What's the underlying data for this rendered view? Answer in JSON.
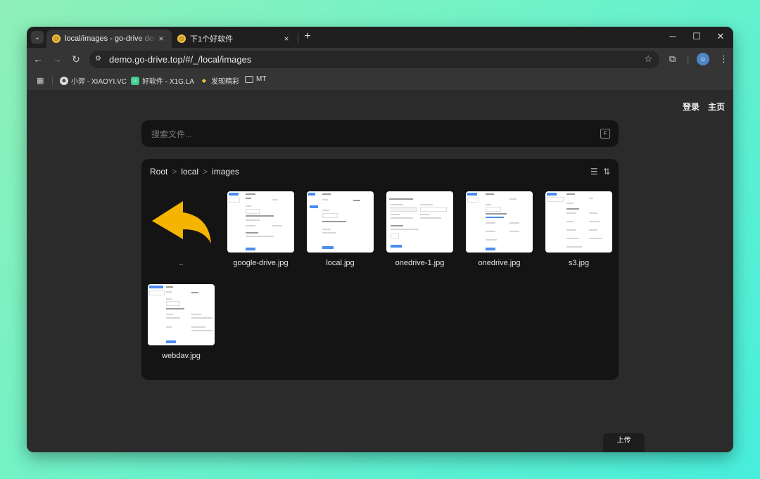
{
  "browser": {
    "tabs": [
      {
        "title": "local/images - go-drive demo",
        "close": "×",
        "favicon": "😉"
      },
      {
        "title": "下1个好软件",
        "close": "×",
        "favicon": "😉"
      }
    ],
    "new_tab": "+",
    "window_controls": {
      "minimize": "─",
      "maximize": "☐",
      "close": "✕"
    },
    "nav": {
      "back": "←",
      "forward": "→",
      "reload": "↻"
    },
    "url": "demo.go-drive.top/#/_/local/images",
    "bookmarks": [
      {
        "label": "小羿 - XIAOYI.VC"
      },
      {
        "label": "好软件 - X1G.LA"
      },
      {
        "label": "发现精彩"
      },
      {
        "label": "MT"
      }
    ]
  },
  "page": {
    "login": "登录",
    "home": "主页",
    "search_placeholder": "搜索文件...",
    "search_shortcut": "F",
    "breadcrumb": [
      "Root",
      "local",
      "images"
    ],
    "breadcrumb_separator": ">",
    "parent_label": "..",
    "files": [
      {
        "name": "google-drive.jpg"
      },
      {
        "name": "local.jpg"
      },
      {
        "name": "onedrive-1.jpg"
      },
      {
        "name": "onedrive.jpg"
      },
      {
        "name": "s3.jpg"
      },
      {
        "name": "webdav.jpg"
      }
    ],
    "upload": "上传",
    "colors": {
      "accent_folder_up": "#f4b400",
      "panel_bg": "#141414",
      "page_bg": "#2b2b2b"
    }
  }
}
